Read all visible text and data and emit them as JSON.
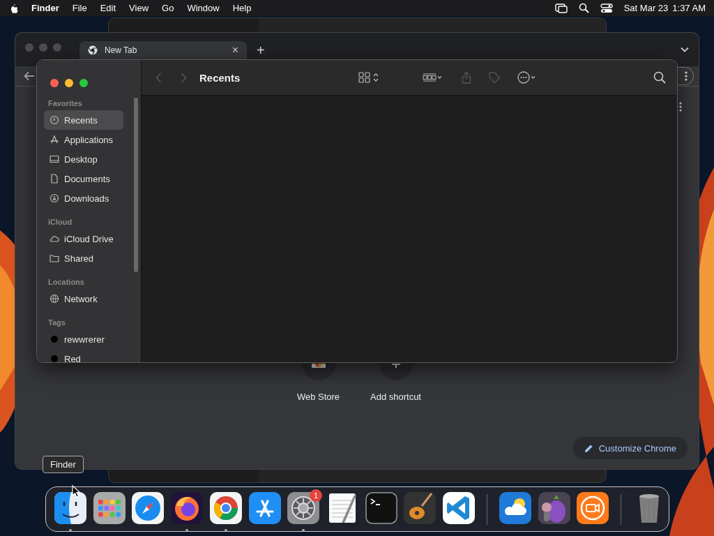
{
  "menubar": {
    "menus": [
      {
        "label": "Finder",
        "kind": "app"
      },
      {
        "label": "File",
        "kind": "menu"
      },
      {
        "label": "Edit",
        "kind": "menu"
      },
      {
        "label": "View",
        "kind": "menu"
      },
      {
        "label": "Go",
        "kind": "menu"
      },
      {
        "label": "Window",
        "kind": "menu"
      },
      {
        "label": "Help",
        "kind": "menu"
      }
    ],
    "date": "Sat Mar 23",
    "time": "1:37 AM"
  },
  "chrome_window": {
    "tabs": [
      {
        "title": "New Tab",
        "close": "×",
        "selected": true
      }
    ],
    "new_tab": "+",
    "shortcuts": [
      {
        "label": "Web Store",
        "kind": "store"
      },
      {
        "label": "Add shortcut",
        "kind": "add"
      }
    ],
    "customize_button": "Customize Chrome"
  },
  "finder_window": {
    "title": "Recents",
    "sidebar": [
      {
        "heading": "Favorites",
        "items": [
          {
            "label": "Recents",
            "kind": "clock",
            "selected": true
          },
          {
            "label": "Applications",
            "kind": "apps",
            "selected": false
          },
          {
            "label": "Desktop",
            "kind": "desktop",
            "selected": false
          },
          {
            "label": "Documents",
            "kind": "doc",
            "selected": false
          },
          {
            "label": "Downloads",
            "kind": "download",
            "selected": false
          }
        ]
      },
      {
        "heading": "iCloud",
        "items": [
          {
            "label": "iCloud Drive",
            "kind": "cloud",
            "selected": false
          },
          {
            "label": "Shared",
            "kind": "shared",
            "selected": false
          }
        ]
      },
      {
        "heading": "Locations",
        "items": [
          {
            "label": "Network",
            "kind": "network",
            "selected": false
          }
        ]
      },
      {
        "heading": "Tags",
        "items": [
          {
            "label": "rewwrerer",
            "kind": "tag",
            "color": "#000000",
            "selected": false
          },
          {
            "label": "Red",
            "kind": "tag",
            "color": "#000000",
            "selected": false
          }
        ]
      }
    ]
  },
  "tooltip": "Finder",
  "dock": {
    "items": [
      {
        "kind": "finder",
        "running": true
      },
      {
        "kind": "launchpad",
        "running": false
      },
      {
        "kind": "safari",
        "running": false
      },
      {
        "kind": "firefox",
        "running": true
      },
      {
        "kind": "chrome",
        "running": true
      },
      {
        "kind": "appstore",
        "running": false
      },
      {
        "kind": "settings",
        "running": true,
        "badge": "1"
      },
      {
        "kind": "textedit",
        "running": false
      },
      {
        "kind": "terminal",
        "running": false
      },
      {
        "kind": "garageband",
        "running": false
      },
      {
        "kind": "vscode",
        "running": false
      },
      {
        "kind": "separator"
      },
      {
        "kind": "weather",
        "running": false
      },
      {
        "kind": "character",
        "running": false
      },
      {
        "kind": "recorder",
        "running": false
      },
      {
        "kind": "separator"
      },
      {
        "kind": "trash",
        "running": false
      }
    ]
  }
}
